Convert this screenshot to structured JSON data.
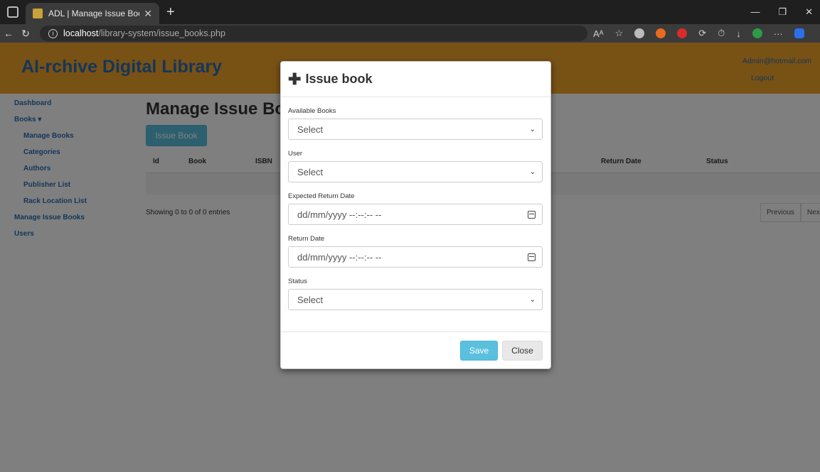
{
  "browser": {
    "tab_title": "ADL | Manage Issue Books",
    "url_host": "localhost",
    "url_path": "/library-system/issue_books.php"
  },
  "site": {
    "brand": "AI-rchive Digital Library",
    "user_email": "Admin@hotmail.com",
    "logout": "Logout"
  },
  "sidebar": {
    "items": [
      {
        "label": "Dashboard",
        "sub": false
      },
      {
        "label": "Books ▾",
        "sub": false
      },
      {
        "label": "Manage Books",
        "sub": true
      },
      {
        "label": "Categories",
        "sub": true
      },
      {
        "label": "Authors",
        "sub": true
      },
      {
        "label": "Publisher List",
        "sub": true
      },
      {
        "label": "Rack Location List",
        "sub": true
      },
      {
        "label": "Manage Issue Books",
        "sub": false
      },
      {
        "label": "Users",
        "sub": false
      }
    ]
  },
  "main": {
    "title": "Manage Issue Books",
    "issue_button": "Issue Book",
    "columns": [
      "Id",
      "Book",
      "ISBN",
      "Return Date",
      "Status"
    ],
    "showing": "Showing 0 to 0 of 0 entries",
    "previous": "Previous",
    "next": "Next"
  },
  "modal": {
    "title": "Issue book",
    "available_books_label": "Available Books",
    "available_books_value": "Select",
    "user_label": "User",
    "user_value": "Select",
    "expected_return_label": "Expected Return Date",
    "expected_return_placeholder": "dd/mm/yyyy --:--:-- --",
    "return_date_label": "Return Date",
    "return_date_placeholder": "dd/mm/yyyy --:--:-- --",
    "status_label": "Status",
    "status_value": "Select",
    "save": "Save",
    "close": "Close"
  }
}
